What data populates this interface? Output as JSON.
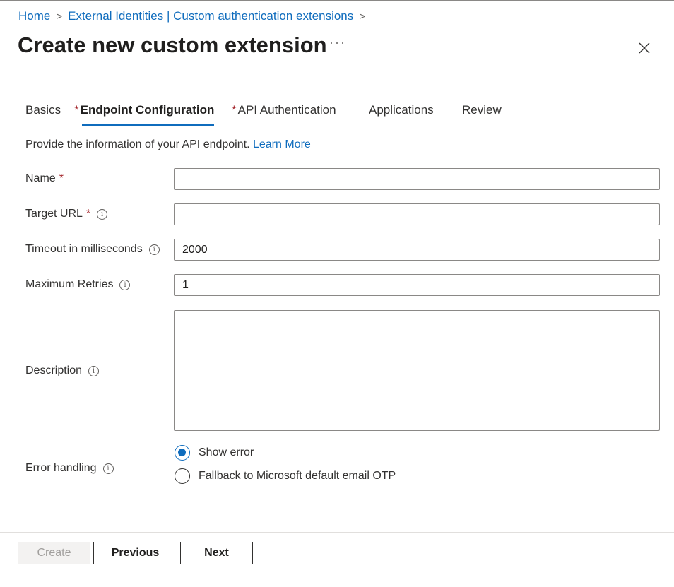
{
  "breadcrumb": {
    "home": "Home",
    "separator": ">",
    "section": "External Identities | Custom authentication extensions"
  },
  "page": {
    "title": "Create new custom extension",
    "more_icon": "ellipsis-icon",
    "close_icon": "close-icon"
  },
  "tabs": [
    {
      "label": "Basics",
      "required": false,
      "active": false
    },
    {
      "label": "Endpoint Configuration",
      "required": true,
      "active": true
    },
    {
      "label": "API Authentication",
      "required": true,
      "active": false
    },
    {
      "label": "Applications",
      "required": false,
      "active": false
    },
    {
      "label": "Review",
      "required": false,
      "active": false
    }
  ],
  "required_marker": "*",
  "intro": {
    "text": "Provide the information of your API endpoint.",
    "link": "Learn More"
  },
  "info_glyph": "i",
  "form": {
    "name": {
      "label": "Name",
      "value": ""
    },
    "target_url": {
      "label": "Target URL",
      "value": ""
    },
    "timeout": {
      "label": "Timeout in milliseconds",
      "value": "2000"
    },
    "max_retries": {
      "label": "Maximum Retries",
      "value": "1"
    },
    "description": {
      "label": "Description",
      "value": ""
    },
    "error_handling": {
      "label": "Error handling",
      "options": [
        {
          "label": "Show error",
          "selected": true
        },
        {
          "label": "Fallback to Microsoft default email OTP",
          "selected": false
        }
      ]
    }
  },
  "footer": {
    "create": "Create",
    "previous": "Previous",
    "next": "Next"
  },
  "colors": {
    "accent": "#0f6cbd",
    "required": "#a4262c",
    "text": "#323130"
  }
}
